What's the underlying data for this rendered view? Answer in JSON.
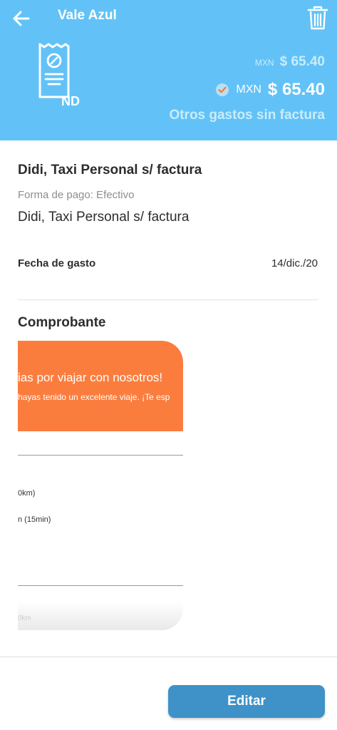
{
  "header": {
    "title": "Vale Azul",
    "back_icon": "arrow-left-icon",
    "delete_icon": "trash-icon",
    "receipt_icon": "receipt-no-invoice-icon",
    "receipt_badge": "ND",
    "amount_original": {
      "currency": "MXN",
      "value": "$ 65.40"
    },
    "amount_approved": {
      "currency": "MXN",
      "value": "$ 65.40",
      "icon": "check-circle-icon"
    },
    "category": "Otros gastos sin factura"
  },
  "detail": {
    "concept_title": "Didi, Taxi Personal s/ factura",
    "payment_method": "Forma de pago: Efectivo",
    "concept_description": "Didi, Taxi Personal s/ factura",
    "date_label": "Fecha de gasto",
    "date_value": "14/dic./20"
  },
  "receipt": {
    "heading": "Comprobante",
    "banner_line1": "ias por viajar con nosotros!",
    "banner_line2": "hayas tenido un excelente viaje. ¡Te esp",
    "line1": "0km)",
    "line2": "n (15min)",
    "line3": "0km"
  },
  "actions": {
    "edit_label": "Editar"
  },
  "colors": {
    "header_bg": "#62c2f7",
    "banner_orange": "#fb7d3e",
    "button_blue": "#3e92c8"
  }
}
